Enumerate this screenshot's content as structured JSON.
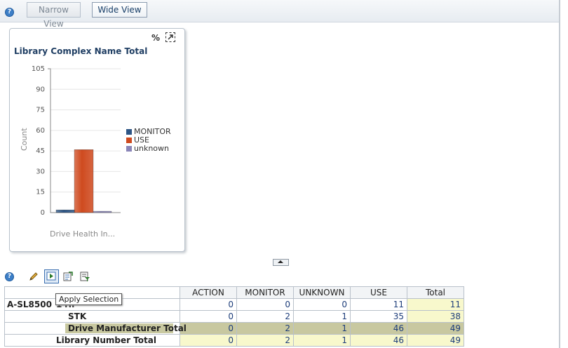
{
  "toolbar": {
    "narrow_label": "Narrow View",
    "wide_label": "Wide View",
    "help_glyph": "?"
  },
  "chart_panel": {
    "pct_icon": "%",
    "maximize_icon": "maximize-icon"
  },
  "chart_data": {
    "type": "bar",
    "title": "Library Complex Name Total",
    "xlabel": "Drive Health In...",
    "ylabel": "Count",
    "ylim": [
      0,
      105
    ],
    "yticks": [
      0,
      15,
      30,
      45,
      60,
      75,
      90,
      105
    ],
    "categories": [
      ""
    ],
    "series": [
      {
        "name": "MONITOR",
        "values": [
          2
        ],
        "color": "#2d5585"
      },
      {
        "name": "USE",
        "values": [
          46
        ],
        "color": "#cf4a1f"
      },
      {
        "name": "unknown",
        "values": [
          1
        ],
        "color": "#8a85b8"
      }
    ],
    "legend_position": "right"
  },
  "actions": {
    "edit_icon": "pencil-icon",
    "apply_icon": "apply-selection-icon",
    "export_icon": "export-icon",
    "filter_icon": "filter-icon",
    "tooltip": "Apply Selection"
  },
  "table": {
    "headers": [
      "ACTION",
      "MONITOR",
      "UNKNOWN",
      "USE",
      "Total"
    ],
    "row_group_label": "A-SL8500",
    "row_group_num": "1",
    "rows": [
      {
        "label": "HP",
        "values": [
          "0",
          "0",
          "0",
          "11"
        ],
        "total": "11"
      },
      {
        "label": "STK",
        "values": [
          "0",
          "2",
          "1",
          "35"
        ],
        "total": "38"
      },
      {
        "label": "Drive Manufacturer Total",
        "values": [
          "0",
          "2",
          "1",
          "46"
        ],
        "total": "49"
      },
      {
        "label": "Library Number Total",
        "values": [
          "0",
          "2",
          "1",
          "46"
        ],
        "total": "49"
      }
    ]
  }
}
